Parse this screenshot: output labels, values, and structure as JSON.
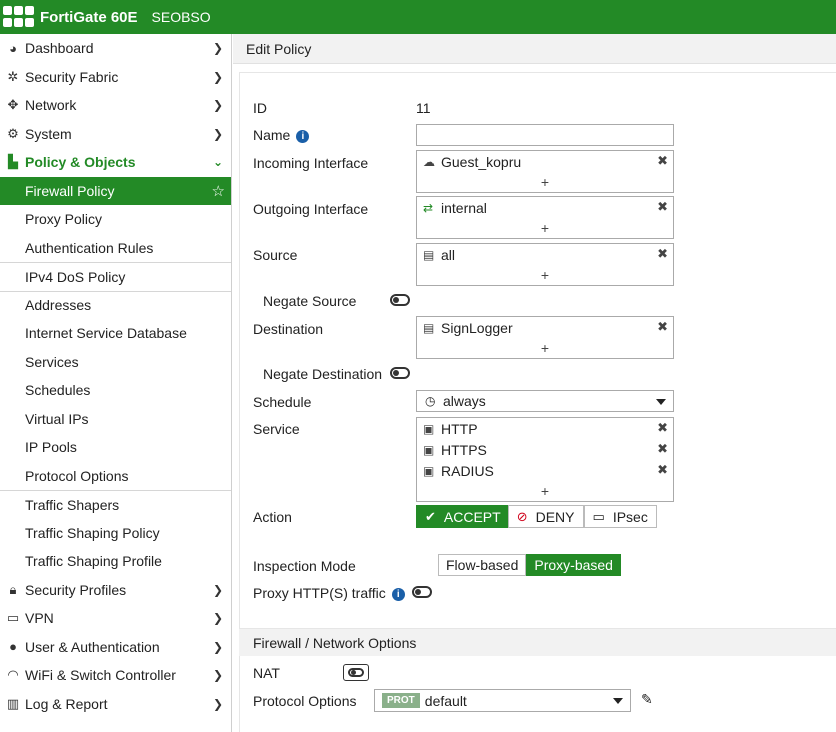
{
  "topbar": {
    "device": "FortiGate 60E",
    "hostname": "SEOBSO"
  },
  "sidebar": {
    "top_items": [
      {
        "label": "Dashboard",
        "icon": "dashboard-icon"
      },
      {
        "label": "Security Fabric",
        "icon": "fabric-icon"
      },
      {
        "label": "Network",
        "icon": "network-icon"
      },
      {
        "label": "System",
        "icon": "gear-icon"
      }
    ],
    "open_item": {
      "label": "Policy & Objects",
      "icon": "policy-icon"
    },
    "sub_items": [
      "Firewall Policy",
      "Proxy Policy",
      "Authentication Rules",
      "IPv4 DoS Policy",
      "Addresses",
      "Internet Service Database",
      "Services",
      "Schedules",
      "Virtual IPs",
      "IP Pools",
      "Protocol Options",
      "Traffic Shapers",
      "Traffic Shaping Policy",
      "Traffic Shaping Profile"
    ],
    "bottom_items": [
      {
        "label": "Security Profiles",
        "icon": "lock-icon"
      },
      {
        "label": "VPN",
        "icon": "laptop-icon"
      },
      {
        "label": "User & Authentication",
        "icon": "user-icon"
      },
      {
        "label": "WiFi & Switch Controller",
        "icon": "wifi-icon"
      },
      {
        "label": "Log & Report",
        "icon": "chart-icon"
      }
    ]
  },
  "header": {
    "title": "Edit Policy"
  },
  "form": {
    "id_label": "ID",
    "id_value": "11",
    "name_label": "Name",
    "name_value": "",
    "incoming_label": "Incoming Interface",
    "incoming_value": "Guest_kopru",
    "outgoing_label": "Outgoing Interface",
    "outgoing_value": "internal",
    "source_label": "Source",
    "source_value": "all",
    "negate_source_label": "Negate Source",
    "destination_label": "Destination",
    "destination_value": "SignLogger",
    "negate_destination_label": "Negate Destination",
    "schedule_label": "Schedule",
    "schedule_value": "always",
    "service_label": "Service",
    "services": [
      "HTTP",
      "HTTPS",
      "RADIUS"
    ],
    "action_label": "Action",
    "actions": {
      "accept": "ACCEPT",
      "deny": "DENY",
      "ipsec": "IPsec"
    },
    "inspection_label": "Inspection Mode",
    "modes": {
      "flow": "Flow-based",
      "proxy": "Proxy-based"
    },
    "proxy_http_label": "Proxy HTTP(S) traffic",
    "plus": "+"
  },
  "firewall_section": {
    "title": "Firewall / Network Options",
    "nat_label": "NAT",
    "protocol_label": "Protocol Options",
    "protocol_badge": "PROT",
    "protocol_value": "default"
  },
  "colors": {
    "brand": "#238a26",
    "info": "#1a5fa8",
    "deny": "#d0021b"
  }
}
